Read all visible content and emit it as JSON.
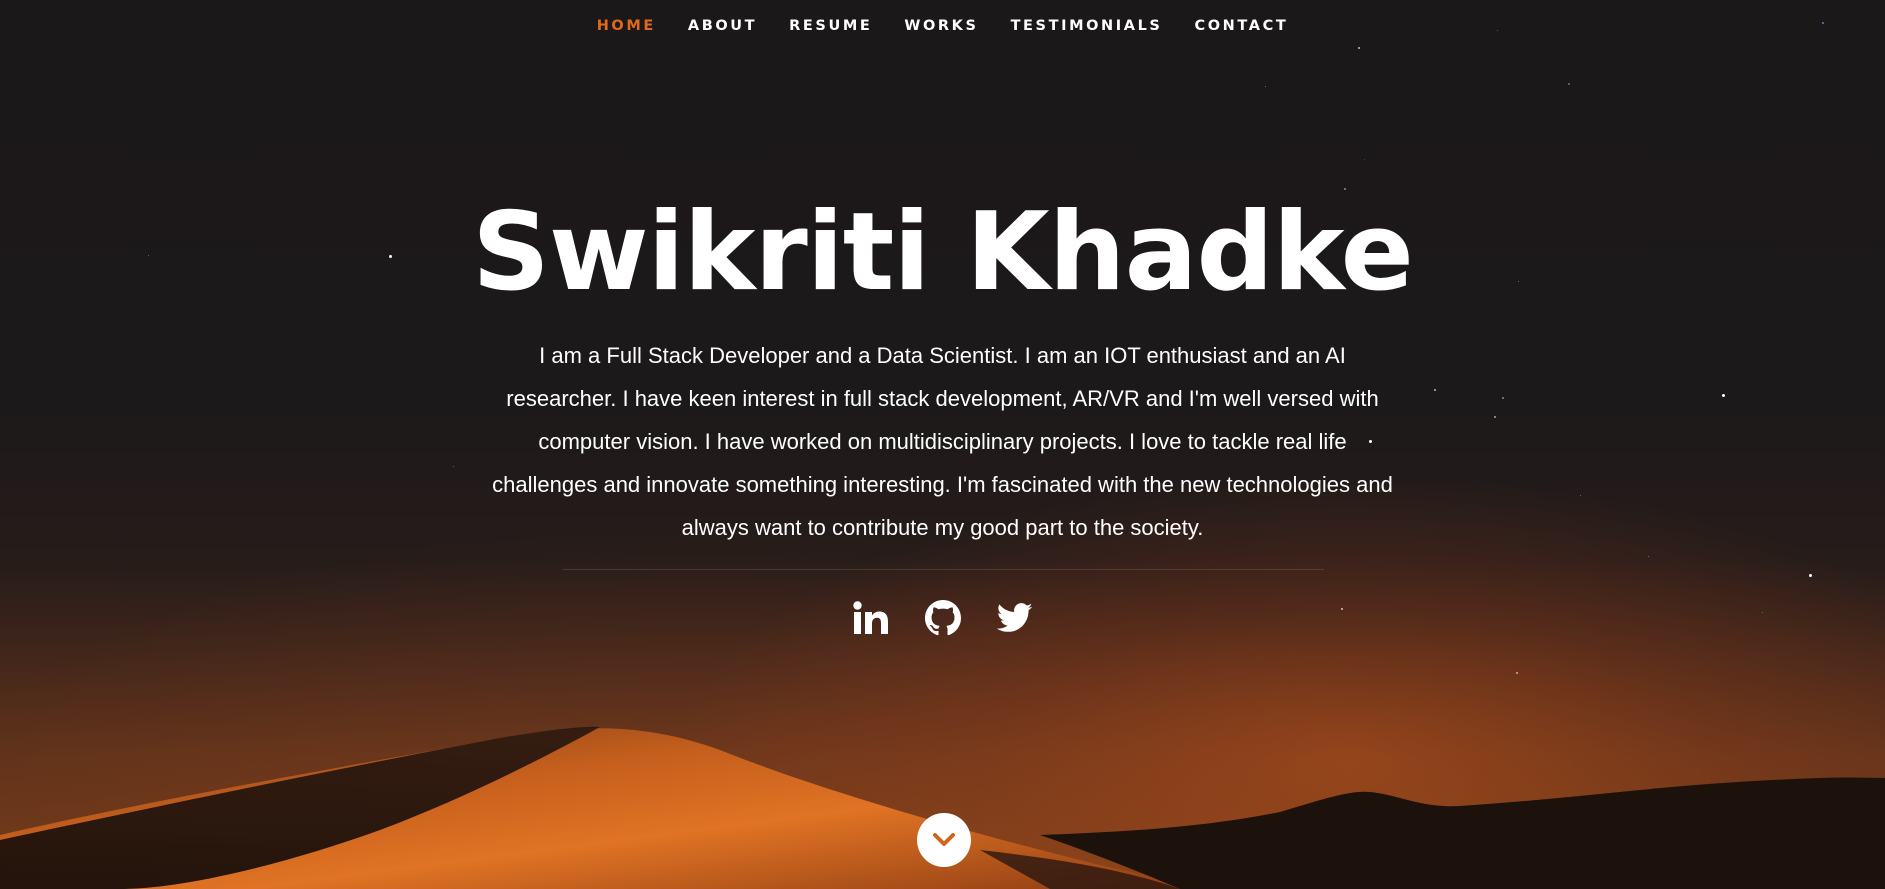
{
  "nav": {
    "items": [
      {
        "label": "HOME",
        "active": true
      },
      {
        "label": "ABOUT",
        "active": false
      },
      {
        "label": "RESUME",
        "active": false
      },
      {
        "label": "WORKS",
        "active": false
      },
      {
        "label": "TESTIMONIALS",
        "active": false
      },
      {
        "label": "CONTACT",
        "active": false
      }
    ]
  },
  "hero": {
    "name": "Swikriti Khadke",
    "bio": "I am a Full Stack Developer and a Data Scientist. I am an IOT enthusiast and an AI researcher. I have keen interest in full stack development, AR/VR and I'm well versed with computer vision. I have worked on multidisciplinary projects. I love to tackle real life challenges and innovate something interesting. I'm fascinated with the new technologies and always want to contribute my good part to the society."
  },
  "social": [
    {
      "icon": "linkedin-icon"
    },
    {
      "icon": "github-icon"
    },
    {
      "icon": "twitter-icon"
    }
  ],
  "scroll": {
    "icon": "chevron-down-icon"
  },
  "colors": {
    "accent": "#e06a1b",
    "text": "#ffffff",
    "background": "#1b1819"
  }
}
